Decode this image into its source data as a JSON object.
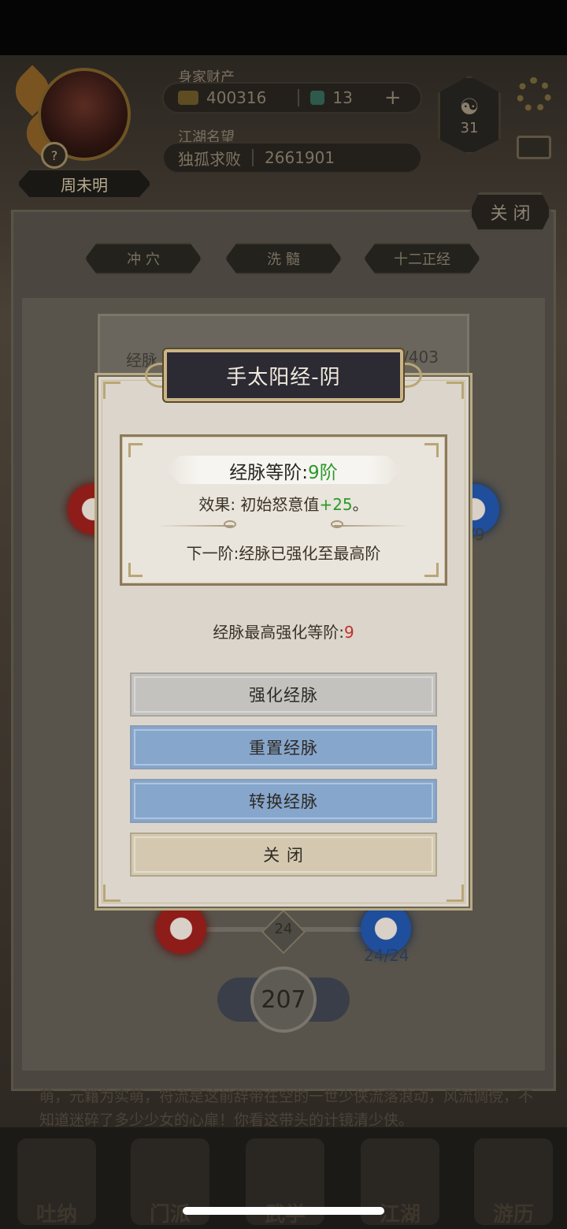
{
  "background": {
    "player": {
      "name": "周未明"
    },
    "resources": {
      "label": "身家财产",
      "gold": "400316",
      "jade": "13",
      "add_symbol": "+"
    },
    "reputation": {
      "label": "江湖名望",
      "title": "独孤求败",
      "value": "2661901"
    },
    "taiji_count": "31",
    "close_label": "关 闭",
    "tabs": [
      "冲 穴",
      "洗 髓",
      "十二正经"
    ],
    "meridian_label": "经脉",
    "meridian_total": "/403",
    "left_count": "/9",
    "node_value": "24",
    "node_progress": "24/24",
    "total_value": "207",
    "story_text": "萌，元籍为实萌，符流是这前辞带在空的一世少侠流落浪动，风流倜傥，不知道迷碎了多少少女的心扉！你看这带头的计镜清少侠。",
    "nav_labels": [
      "吐纳",
      "门派",
      "武学",
      "江湖",
      "游历"
    ]
  },
  "dialog": {
    "title": "手太阳经-阴",
    "grade_label": "经脉等阶:",
    "grade_value": "9",
    "grade_unit": "阶",
    "effect_label": "效果: 初始怒意值",
    "effect_value": "+25",
    "effect_suffix": "。",
    "next_label": "下一阶:经脉已强化至最高阶",
    "max_label": "经脉最高强化等阶:",
    "max_value": "9",
    "buttons": {
      "enhance": "强化经脉",
      "reset": "重置经脉",
      "convert": "转换经脉",
      "close": "关 闭"
    }
  },
  "colors": {
    "green_value": "#2a9a2a",
    "red_value": "#c03228",
    "blue_button": "#86a6cc",
    "gray_button": "#c4c2bf",
    "tan_button": "#d4c9b0"
  }
}
